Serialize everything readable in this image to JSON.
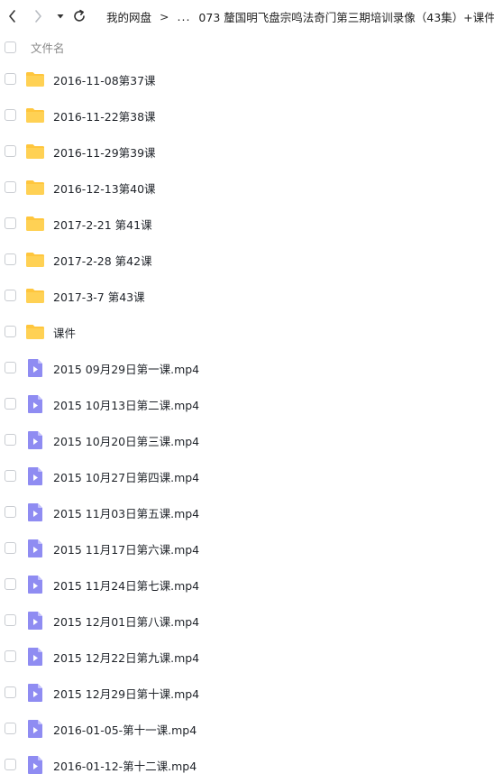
{
  "toolbar": {
    "breadcrumb_root": "我的网盘",
    "breadcrumb_sep": ">",
    "breadcrumb_ellipsis": "...",
    "breadcrumb_current": "073 釐国明飞盘宗鸣法奇门第三期培训录像（43集）+课件",
    "breadcrumb_trailing_sep": ">"
  },
  "header": {
    "name_column": "文件名"
  },
  "colors": {
    "folder": "#ffd154",
    "folder_tab": "#ffc63d",
    "video": "#8f8cf2",
    "video_fold": "#c4c2fb"
  },
  "files": [
    {
      "name": "2016-11-08第37课",
      "icon": "folder-icon"
    },
    {
      "name": "2016-11-22第38课",
      "icon": "folder-icon"
    },
    {
      "name": "2016-11-29第39课",
      "icon": "folder-icon"
    },
    {
      "name": "2016-12-13第40课",
      "icon": "folder-icon"
    },
    {
      "name": "2017-2-21 第41课",
      "icon": "folder-icon"
    },
    {
      "name": "2017-2-28 第42课",
      "icon": "folder-icon"
    },
    {
      "name": "2017-3-7 第43课",
      "icon": "folder-icon"
    },
    {
      "name": "课件",
      "icon": "folder-icon"
    },
    {
      "name": "2015 09月29日第一课.mp4",
      "icon": "video-file-icon"
    },
    {
      "name": "2015 10月13日第二课.mp4",
      "icon": "video-file-icon"
    },
    {
      "name": "2015 10月20日第三课.mp4",
      "icon": "video-file-icon"
    },
    {
      "name": "2015 10月27日第四课.mp4",
      "icon": "video-file-icon"
    },
    {
      "name": "2015 11月03日第五课.mp4",
      "icon": "video-file-icon"
    },
    {
      "name": "2015 11月17日第六课.mp4",
      "icon": "video-file-icon"
    },
    {
      "name": "2015 11月24日第七课.mp4",
      "icon": "video-file-icon"
    },
    {
      "name": "2015 12月01日第八课.mp4",
      "icon": "video-file-icon"
    },
    {
      "name": "2015 12月22日第九课.mp4",
      "icon": "video-file-icon"
    },
    {
      "name": "2015 12月29日第十课.mp4",
      "icon": "video-file-icon"
    },
    {
      "name": "2016-01-05-第十一课.mp4",
      "icon": "video-file-icon"
    },
    {
      "name": "2016-01-12-第十二课.mp4",
      "icon": "video-file-icon"
    }
  ]
}
